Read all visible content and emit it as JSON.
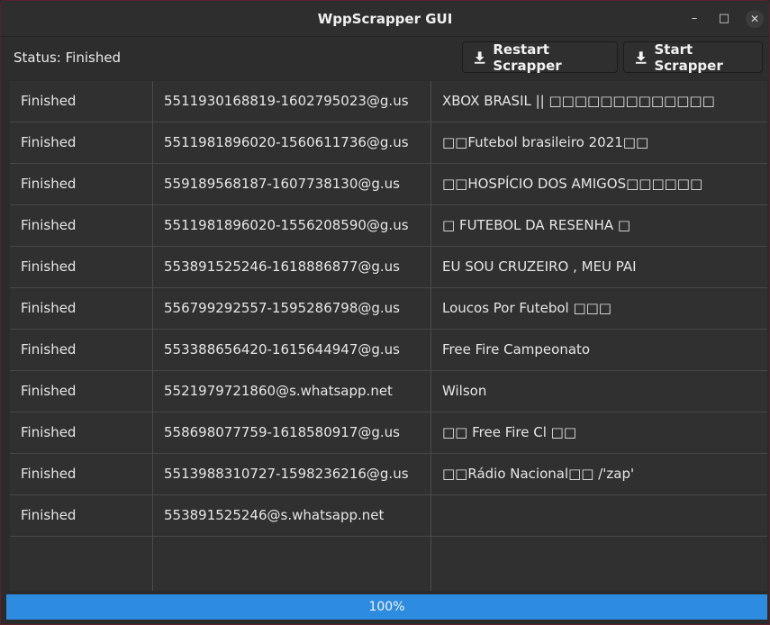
{
  "window": {
    "title": "WppScrapper GUI",
    "min_glyph": "–",
    "max_glyph": "□",
    "close_glyph": "✕"
  },
  "toolbar": {
    "status_text": "Status: Finished",
    "restart_label": "Restart Scrapper",
    "start_label": "Start Scrapper"
  },
  "table": {
    "rows": [
      [
        "Finished",
        "5511930168819-1602795023@g.us",
        "XBOX BRASIL || □□□□□□□□□□□□□"
      ],
      [
        "Finished",
        "5511981896020-1560611736@g.us",
        "□□Futebol brasileiro 2021□□"
      ],
      [
        "Finished",
        "559189568187-1607738130@g.us",
        "□□HOSPÍCIO DOS AMIGOS□□□□□□"
      ],
      [
        "Finished",
        "5511981896020-1556208590@g.us",
        "□ FUTEBOL DA RESENHA □"
      ],
      [
        "Finished",
        "553891525246-1618886877@g.us",
        "EU SOU CRUZEIRO , MEU PAI"
      ],
      [
        "Finished",
        "556799292557-1595286798@g.us",
        "Loucos Por Futebol □□□"
      ],
      [
        "Finished",
        "553388656420-1615644947@g.us",
        "Free Fire Campeonato"
      ],
      [
        "Finished",
        "5521979721860@s.whatsapp.net",
        "Wilson"
      ],
      [
        "Finished",
        "558698077759-1618580917@g.us",
        "□□ Free Fire Cl □□"
      ],
      [
        "Finished",
        "5513988310727-1598236216@g.us",
        "□□Rádio Nacional□□ /'zap'"
      ],
      [
        "Finished",
        "553891525246@s.whatsapp.net",
        ""
      ]
    ]
  },
  "progress": {
    "value": 1.0,
    "label": "100%"
  },
  "colors": {
    "accent": "#2d8ce0",
    "background": "#2b2b2b"
  },
  "icons": {
    "button_icon": "download-icon"
  }
}
